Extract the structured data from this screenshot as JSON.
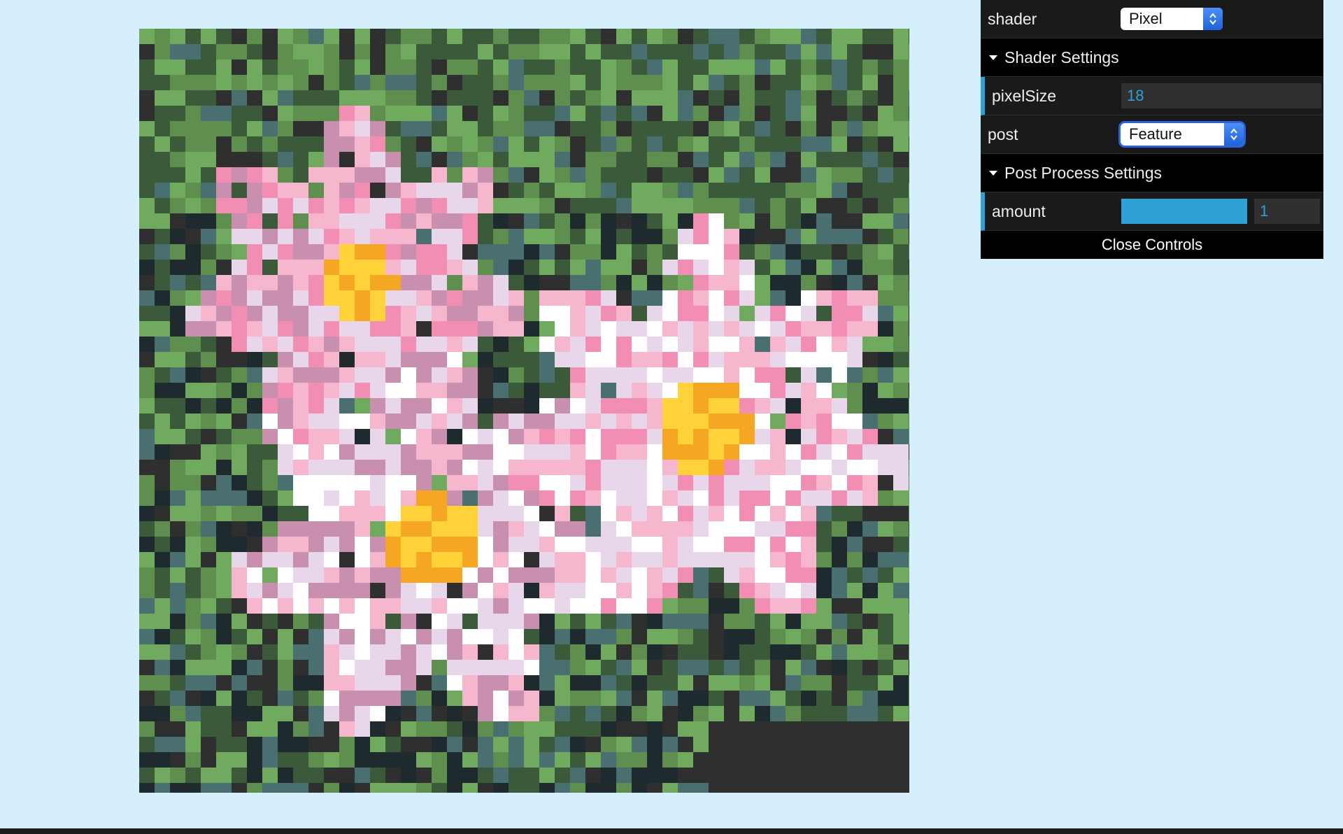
{
  "canvas": {
    "alt": "pixelated water lilies",
    "palette": [
      "#3b5a3a",
      "#5f8f4e",
      "#6faa5f",
      "#2f2f2f",
      "#f6b6cd",
      "#f28db4",
      "#e8d6ea",
      "#ffffff",
      "#ffd23a",
      "#f5a623",
      "#1f2a2f",
      "#4a6f70",
      "#8a5a6a",
      "#c98fae"
    ]
  },
  "gui": {
    "shader": {
      "label": "shader",
      "value": "Pixel"
    },
    "shader_settings": {
      "title": "Shader Settings",
      "pixelSize": {
        "label": "pixelSize",
        "value": "18"
      }
    },
    "post": {
      "label": "post",
      "value": "Feature"
    },
    "post_settings": {
      "title": "Post Process Settings",
      "amount": {
        "label": "amount",
        "value": "1",
        "fill": 1.0
      }
    },
    "close_label": "Close Controls",
    "accent": "#2fa1d6",
    "focus": "#2b64d9"
  }
}
